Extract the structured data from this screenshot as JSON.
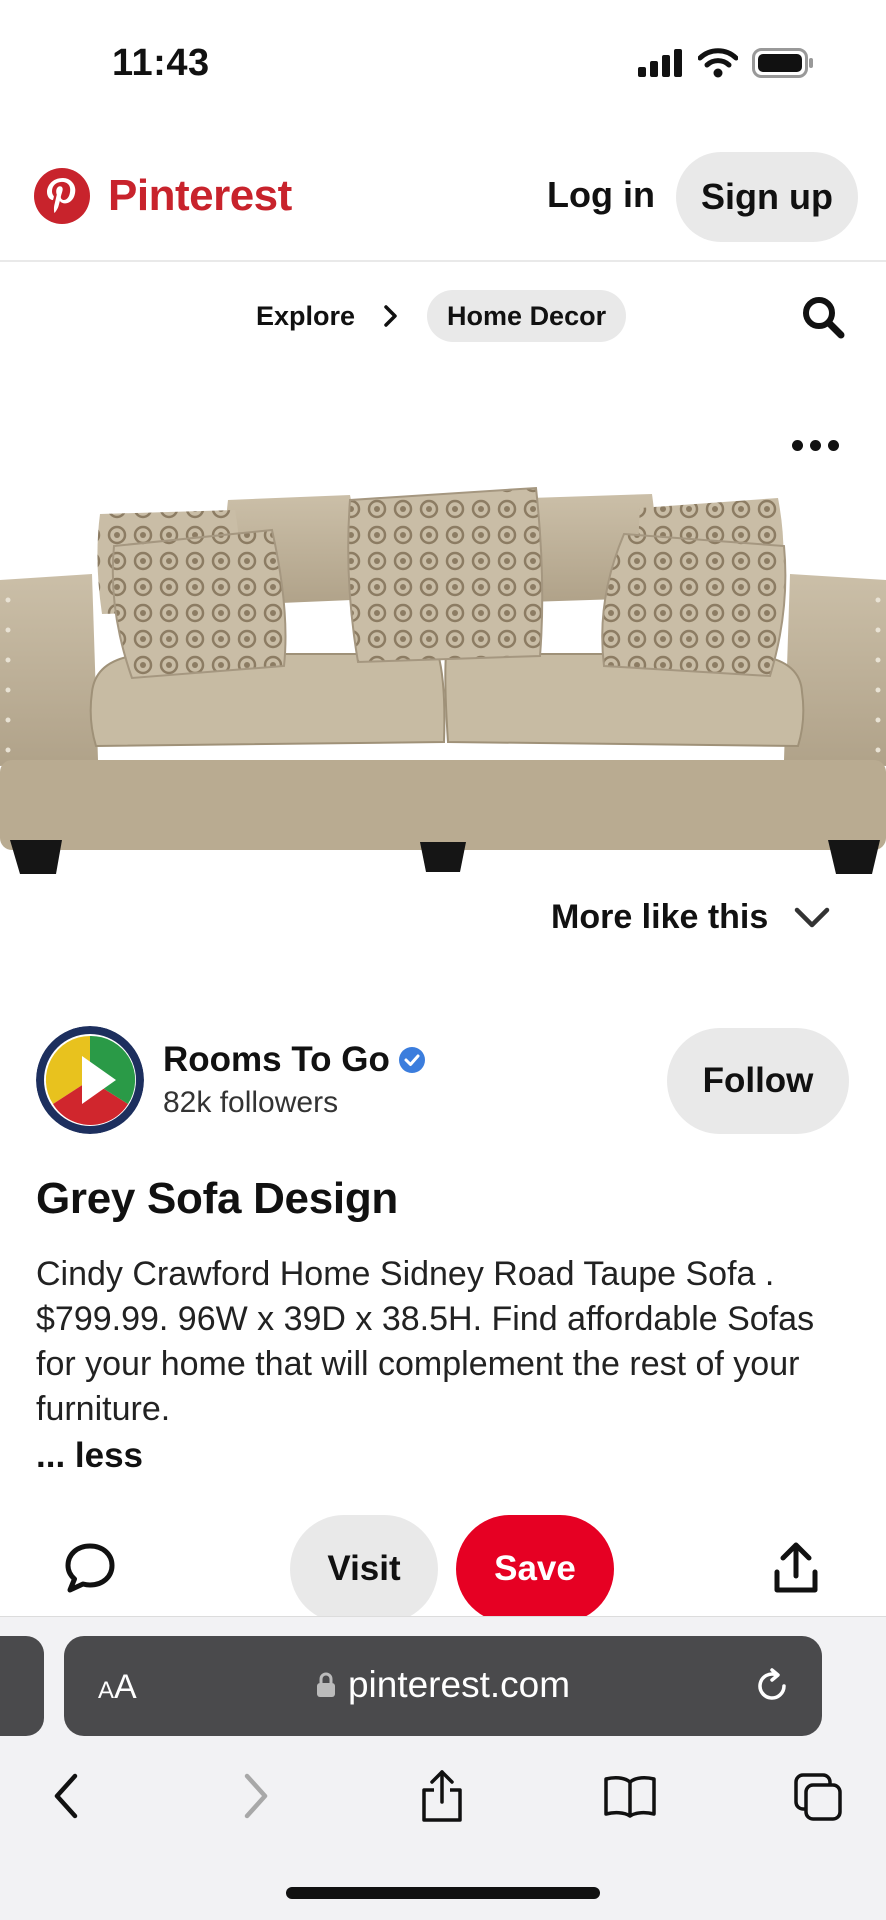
{
  "status": {
    "time": "11:43"
  },
  "header": {
    "brand": "Pinterest",
    "login_label": "Log in",
    "signup_label": "Sign up"
  },
  "breadcrumb": {
    "explore_label": "Explore",
    "category_label": "Home Decor"
  },
  "pin": {
    "more_like_label": "More like this",
    "creator_name": "Rooms To Go",
    "followers": "82k followers",
    "follow_label": "Follow",
    "title": "Grey Sofa Design",
    "description": "Cindy Crawford Home Sidney Road Taupe Sofa . $799.99. 96W x 39D x 38.5H. Find affordable Sofas for your home that will complement the rest of your furniture.",
    "less_label": "... less",
    "visit_label": "Visit",
    "save_label": "Save"
  },
  "browser": {
    "aa_label_big": "A",
    "aa_label_small": "A",
    "url": "pinterest.com"
  },
  "colors": {
    "brand_red": "#c8232c",
    "save_red": "#e60023",
    "chip_grey": "#e9e9e9",
    "verified_blue": "#3b7ddd"
  },
  "icons": [
    "signal-icon",
    "wifi-icon",
    "battery-icon",
    "pinterest-logo-icon",
    "chevron-right-icon",
    "search-icon",
    "more-icon",
    "chevron-down-icon",
    "verified-badge-icon",
    "comment-icon",
    "share-icon",
    "lock-icon",
    "reload-icon",
    "back-icon",
    "forward-icon",
    "safari-share-icon",
    "bookmarks-icon",
    "tabs-icon"
  ]
}
